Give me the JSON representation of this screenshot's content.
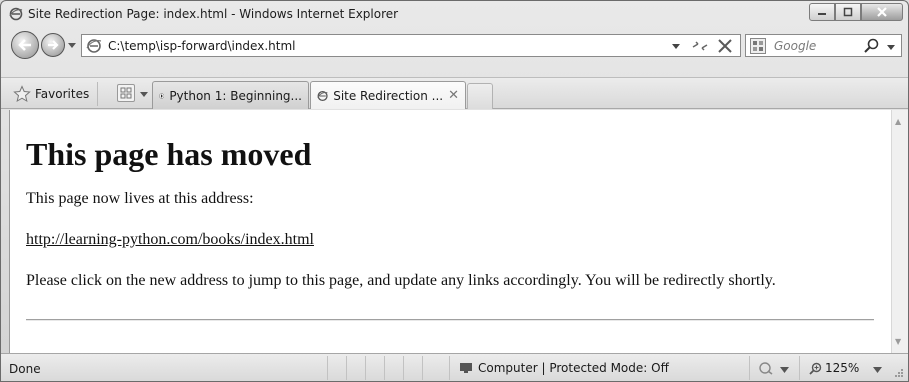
{
  "window": {
    "title": "Site Redirection Page: index.html - Windows Internet Explorer"
  },
  "address_bar": {
    "url": "C:\\temp\\isp-forward\\index.html"
  },
  "search": {
    "placeholder": "Google"
  },
  "favorites": {
    "label": "Favorites"
  },
  "tabs": [
    {
      "label": "Python 1: Beginning...",
      "active": false
    },
    {
      "label": "Site Redirection ...",
      "active": true
    }
  ],
  "page": {
    "heading": "This page has moved",
    "intro": "This page now lives at this address:",
    "link": "http://learning-python.com/books/index.html",
    "message": "Please click on the new address to jump to this page, and update any links accordingly. You will be redirectly shortly."
  },
  "status_bar": {
    "text": "Done",
    "zone": "Computer | Protected Mode: Off",
    "zoom": "125%"
  },
  "icons": {
    "ie": "ie-logo-icon",
    "back": "back-arrow-icon",
    "forward": "forward-arrow-icon",
    "compat": "compatibility-view-icon",
    "stop": "stop-icon",
    "search_go": "magnifier-icon",
    "favorites": "star-icon",
    "quick_tabs": "quick-tabs-icon",
    "zone": "computer-icon",
    "zoom": "zoom-icon"
  }
}
